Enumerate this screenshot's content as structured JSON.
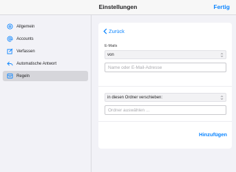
{
  "header": {
    "title": "Einstellungen",
    "done_label": "Fertig"
  },
  "sidebar": {
    "items": [
      {
        "label": "Allgemein",
        "icon": "gear-icon"
      },
      {
        "label": "Accounts",
        "icon": "at-sign-icon"
      },
      {
        "label": "Verfassen",
        "icon": "compose-icon"
      },
      {
        "label": "Automatische Antwort",
        "icon": "reply-icon"
      },
      {
        "label": "Regeln",
        "icon": "rules-icon",
        "selected": true
      }
    ]
  },
  "rule_editor": {
    "back_label": "Zurück",
    "condition_section_label": "E-Mails",
    "condition_select_value": "von",
    "condition_input_placeholder": "Name oder E-Mail-Adresse",
    "action_select_value": "in diesen Ordner verschieben:",
    "folder_input_placeholder": "Ordner auswählen ...",
    "add_label": "Hinzufügen"
  },
  "colors": {
    "accent": "#0a84ff",
    "selected_row": "#d6d6db"
  }
}
